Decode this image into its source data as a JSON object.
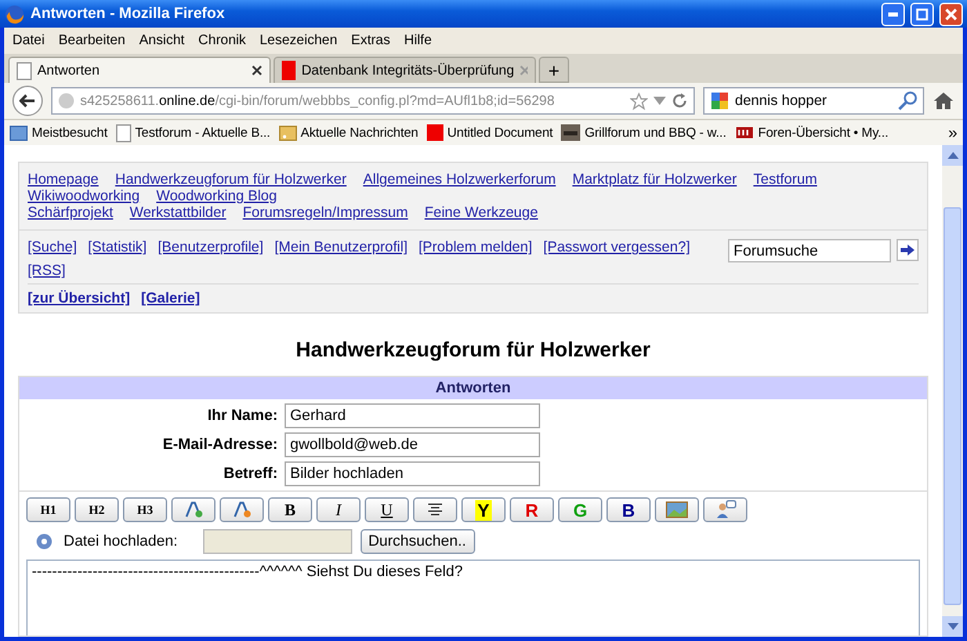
{
  "window": {
    "title": "Antworten - Mozilla Firefox"
  },
  "menu": [
    "Datei",
    "Bearbeiten",
    "Ansicht",
    "Chronik",
    "Lesezeichen",
    "Extras",
    "Hilfe"
  ],
  "tabs": [
    {
      "label": "Antworten",
      "selected": true
    },
    {
      "label": "Datenbank Integritäts-Überprüfung",
      "selected": false
    }
  ],
  "tab_new": "+",
  "address": {
    "url": "s425258611.**online.de**/cgi-bin/forum/webbbs_config.pl?md=AUfl1b8;id=56298"
  },
  "search": {
    "value": "dennis hopper"
  },
  "bookmarks": [
    {
      "label": "Meistbesucht",
      "kind": "special"
    },
    {
      "label": "Testforum - Aktuelle B...",
      "kind": "page"
    },
    {
      "label": "Aktuelle Nachrichten",
      "kind": "feed"
    },
    {
      "label": "Untitled Document",
      "kind": "red"
    },
    {
      "label": "Grillforum und BBQ - w...",
      "kind": "photo"
    },
    {
      "label": "Foren-Übersicht • My...",
      "kind": "logo"
    }
  ],
  "bookmarks_more": "»",
  "forum_links": [
    [
      "Homepage",
      "Handwerkzeugforum für Holzwerker",
      "Allgemeines Holzwerkerforum",
      "Marktplatz für Holzwerker",
      "Testforum",
      "Wikiwoodworking",
      "Woodworking Blog"
    ],
    [
      "Schärfprojekt",
      "Werkstattbilder",
      "Forumsregeln/Impressum",
      "Feine Werkzeuge"
    ]
  ],
  "tool_links": [
    "[Suche]",
    "[Statistik]",
    "[Benutzerprofile]",
    "[Mein Benutzerprofil]",
    "[Problem melden]",
    "[Passwort vergessen?]",
    "[RSS]"
  ],
  "forum_search": {
    "value": "Forumsuche"
  },
  "section_links": [
    "[zur Übersicht]",
    "[Galerie]"
  ],
  "heading": "Handwerkzeugforum für Holzwerker",
  "form": {
    "title": "Antworten",
    "fields": [
      {
        "label": "Ihr Name:",
        "value": "Gerhard"
      },
      {
        "label": "E-Mail-Adresse:",
        "value": "gwollbold@web.de"
      },
      {
        "label": "Betreff:",
        "value": "Bilder hochladen"
      }
    ],
    "toolbar": [
      {
        "kind": "heading",
        "label": "H1"
      },
      {
        "kind": "heading",
        "label": "H2"
      },
      {
        "kind": "heading",
        "label": "H3"
      },
      {
        "kind": "fontcolor"
      },
      {
        "kind": "fontbg"
      },
      {
        "kind": "bold",
        "label": "B"
      },
      {
        "kind": "italic",
        "label": "I"
      },
      {
        "kind": "underline",
        "label": "U"
      },
      {
        "kind": "align"
      },
      {
        "kind": "highlight",
        "label": "Y",
        "color": "#ffff00"
      },
      {
        "kind": "color",
        "label": "R",
        "color": "#e00000"
      },
      {
        "kind": "color",
        "label": "G",
        "color": "#10a010"
      },
      {
        "kind": "color",
        "label": "B",
        "color": "#000090"
      },
      {
        "kind": "image"
      },
      {
        "kind": "user"
      }
    ],
    "upload": {
      "label": "Datei hochladen:",
      "button": "Durchsuchen.."
    },
    "message": "---------------------------------------------^^^^^^ Siehst Du dieses Feld?"
  }
}
